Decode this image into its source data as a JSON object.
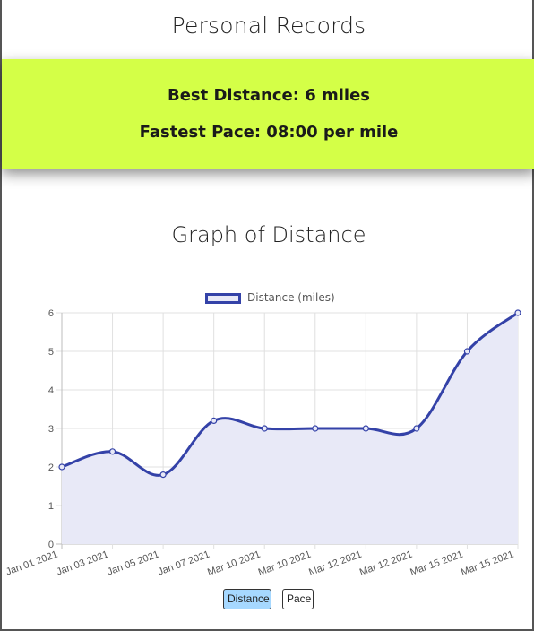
{
  "header": {
    "title": "Personal Records"
  },
  "records": {
    "best_distance": "Best Distance: 6 miles",
    "fastest_pace": "Fastest Pace: 08:00 per mile"
  },
  "graph": {
    "title": "Graph of Distance"
  },
  "chart_data": {
    "type": "line",
    "categories": [
      "Jan 01 2021",
      "Jan 03 2021",
      "Jan 05 2021",
      "Jan 07 2021",
      "Mar 10 2021",
      "Mar 10 2021",
      "Mar 12 2021",
      "Mar 12 2021",
      "Mar 15 2021",
      "Mar 15 2021"
    ],
    "series": [
      {
        "name": "Distance (miles)",
        "values": [
          2,
          2.4,
          1.8,
          3.2,
          3,
          3,
          3,
          3,
          5,
          6
        ]
      }
    ],
    "ylim": [
      0,
      6
    ],
    "yticks": [
      0,
      1,
      2,
      3,
      4,
      5,
      6
    ],
    "grid": true,
    "legend": "top-center",
    "fill": true,
    "colors": {
      "line": "#3442a8",
      "fill": "#e8e9f7",
      "grid": "#e0e0e0"
    }
  },
  "buttons": {
    "distance": "Distance",
    "pace": "Pace"
  },
  "colors": {
    "panel": "#d4ff47",
    "active_button": "#a6d8ff"
  }
}
